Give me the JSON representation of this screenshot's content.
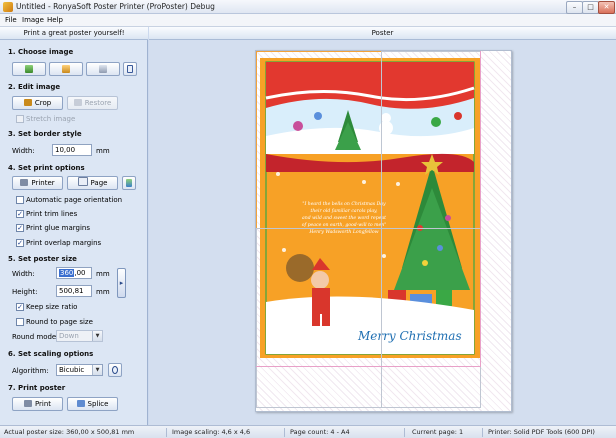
{
  "window": {
    "title": "Untitled - RonyaSoft Poster Printer (ProPoster) Debug",
    "min_glyph": "–",
    "max_glyph": "□",
    "close_glyph": "✕"
  },
  "menu": {
    "items": [
      "File",
      "Image",
      "Help"
    ]
  },
  "left_panel": {
    "header": "Print a great poster yourself!",
    "choose_image": {
      "title": "1. Choose image"
    },
    "edit_image": {
      "title": "2. Edit image",
      "crop_label": "Crop",
      "restore_label": "Restore",
      "stretch_label": "Stretch image"
    },
    "border_style": {
      "title": "3. Set border style",
      "width_label": "Width:",
      "width_value": "10,00",
      "unit": "mm"
    },
    "print_options": {
      "title": "4. Set print options",
      "printer_label": "Printer",
      "page_label": "Page",
      "checkboxes": [
        {
          "label": "Automatic page orientation",
          "checked": false
        },
        {
          "label": "Print trim lines",
          "checked": true
        },
        {
          "label": "Print glue margins",
          "checked": true
        },
        {
          "label": "Print overlap margins",
          "checked": true
        }
      ]
    },
    "poster_size": {
      "title": "5. Set poster size",
      "width_label": "Width:",
      "width_value": "360",
      "width_rest": ",00",
      "height_label": "Height:",
      "height_value": "500,81",
      "unit": "mm",
      "keep_ratio_label": "Keep size ratio",
      "keep_ratio_checked": true,
      "round_label": "Round to page size",
      "round_checked": false,
      "round_mode_label": "Round mode:",
      "round_mode_value": "Down"
    },
    "scaling": {
      "title": "6. Set scaling options",
      "algorithm_label": "Algorithm:",
      "algorithm_value": "Bicubic"
    },
    "print_poster": {
      "title": "7. Print poster",
      "print_label": "Print",
      "splice_label": "Splice"
    }
  },
  "poster": {
    "header": "Poster",
    "greeting": "Merry Christmas",
    "poem": [
      "\"I heard the bells on Christmas Day",
      "their old familiar carols play,",
      "and wild and sweet the word repeat",
      "of peace on earth, good-will to men\"",
      "Henry Wadsworth Longfellow"
    ]
  },
  "status": {
    "poster_size": "Actual poster size: 360,00 x 500,81 mm",
    "image_scaling": "Image scaling: 4,6 x 4,6",
    "page_count": "Page count: 4 - A4",
    "current_page": "Current page: 1",
    "printer": "Printer: Solid PDF Tools (600 DPI)"
  },
  "colors": {
    "accent": "#3a6fd0",
    "poster_orange": "#f7a126",
    "page_border": "#f2a23a",
    "overlap_pink": "#e8a0c8",
    "glue_green": "#3aa845"
  }
}
